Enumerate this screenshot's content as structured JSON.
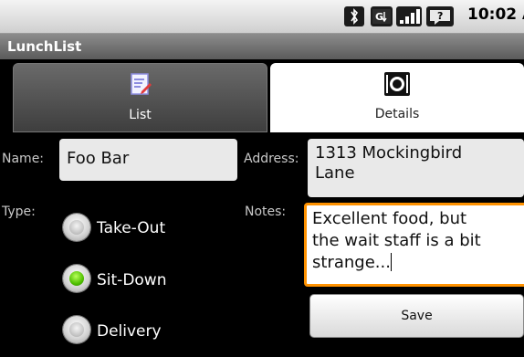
{
  "status_bar": {
    "icons": [
      "bluetooth-icon",
      "data-transfer-icon",
      "signal-icon",
      "alert-icon"
    ],
    "time": "10:02 AM"
  },
  "app": {
    "title": "LunchList"
  },
  "tabs": [
    {
      "label": "List",
      "icon": "list-edit-icon"
    },
    {
      "label": "Details",
      "icon": "restaurant-icon"
    }
  ],
  "form": {
    "name_label": "Name:",
    "name_value": "Foo Bar",
    "address_label": "Address:",
    "address_line1": "1313 Mockingbird",
    "address_line2": "Lane",
    "type_label": "Type:",
    "types": [
      {
        "label": "Take-Out",
        "checked": false
      },
      {
        "label": "Sit-Down",
        "checked": true
      },
      {
        "label": "Delivery",
        "checked": false
      }
    ],
    "notes_label": "Notes:",
    "notes_line1": "Excellent food, but",
    "notes_line2": "the wait staff is a bit",
    "notes_line3": "strange...",
    "save_label": "Save"
  },
  "colors": {
    "focus_border": "#ff9200",
    "radio_checked": "#4fbf00"
  }
}
